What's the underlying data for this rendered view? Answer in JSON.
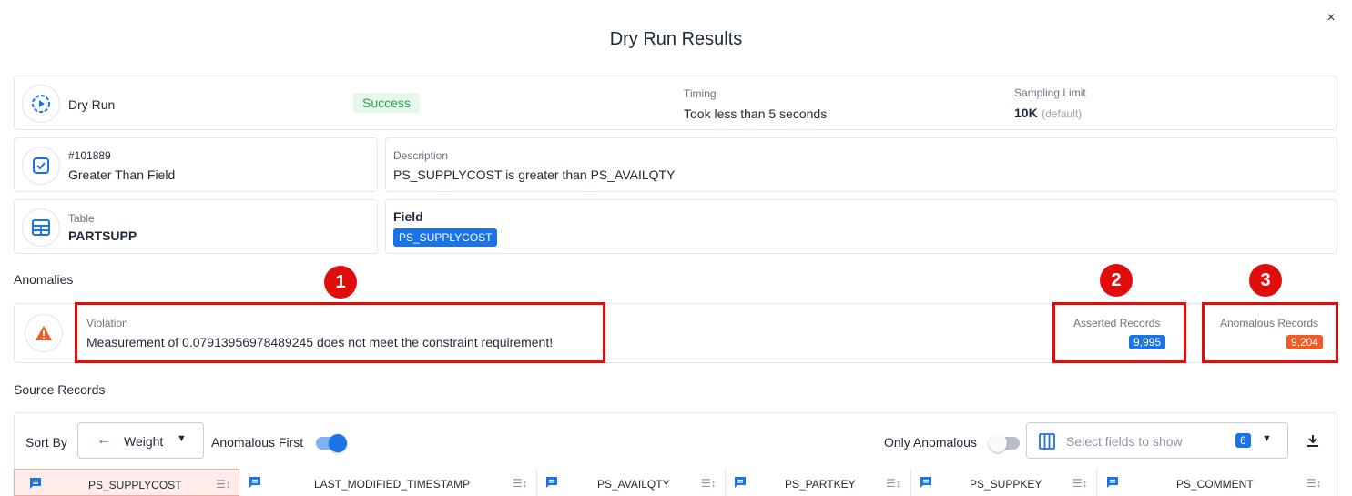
{
  "modal": {
    "title": "Dry Run Results",
    "close_label": "×"
  },
  "summary": {
    "dry_run_label": "Dry Run",
    "status": "Success",
    "timing_label": "Timing",
    "timing_value": "Took less than 5 seconds",
    "sampling_label": "Sampling Limit",
    "sampling_value": "10K",
    "sampling_note": "(default)"
  },
  "check": {
    "id": "#101889",
    "name": "Greater Than Field",
    "description_label": "Description",
    "description_value": "PS_SUPPLYCOST is greater than PS_AVAILQTY"
  },
  "table_info": {
    "table_label": "Table",
    "table_value": "PARTSUPP",
    "field_label": "Field",
    "field_value": "PS_SUPPLYCOST"
  },
  "anomalies": {
    "section_title": "Anomalies",
    "violation_label": "Violation",
    "violation_text": "Measurement of 0.07913956978489245 does not meet the constraint requirement!",
    "asserted_label": "Asserted Records",
    "asserted_count": "9,995",
    "anomalous_label": "Anomalous Records",
    "anomalous_count": "9,204"
  },
  "callouts": [
    "1",
    "2",
    "3"
  ],
  "source_records": {
    "section_title": "Source Records",
    "sort_by_label": "Sort By",
    "sort_value": "Weight",
    "anomalous_first_label": "Anomalous First",
    "anomalous_first_on": true,
    "only_anomalous_label": "Only Anomalous",
    "only_anomalous_on": false,
    "fields_placeholder": "Select fields to show",
    "fields_count": "6",
    "columns": [
      "PS_SUPPLYCOST",
      "LAST_MODIFIED_TIMESTAMP",
      "PS_AVAILQTY",
      "PS_PARTKEY",
      "PS_SUPPKEY",
      "PS_COMMENT"
    ]
  },
  "colors": {
    "accent": "#1a73e8",
    "success": "#22a94a",
    "anomaly": "#f05a24",
    "callout": "#e10d0d"
  }
}
